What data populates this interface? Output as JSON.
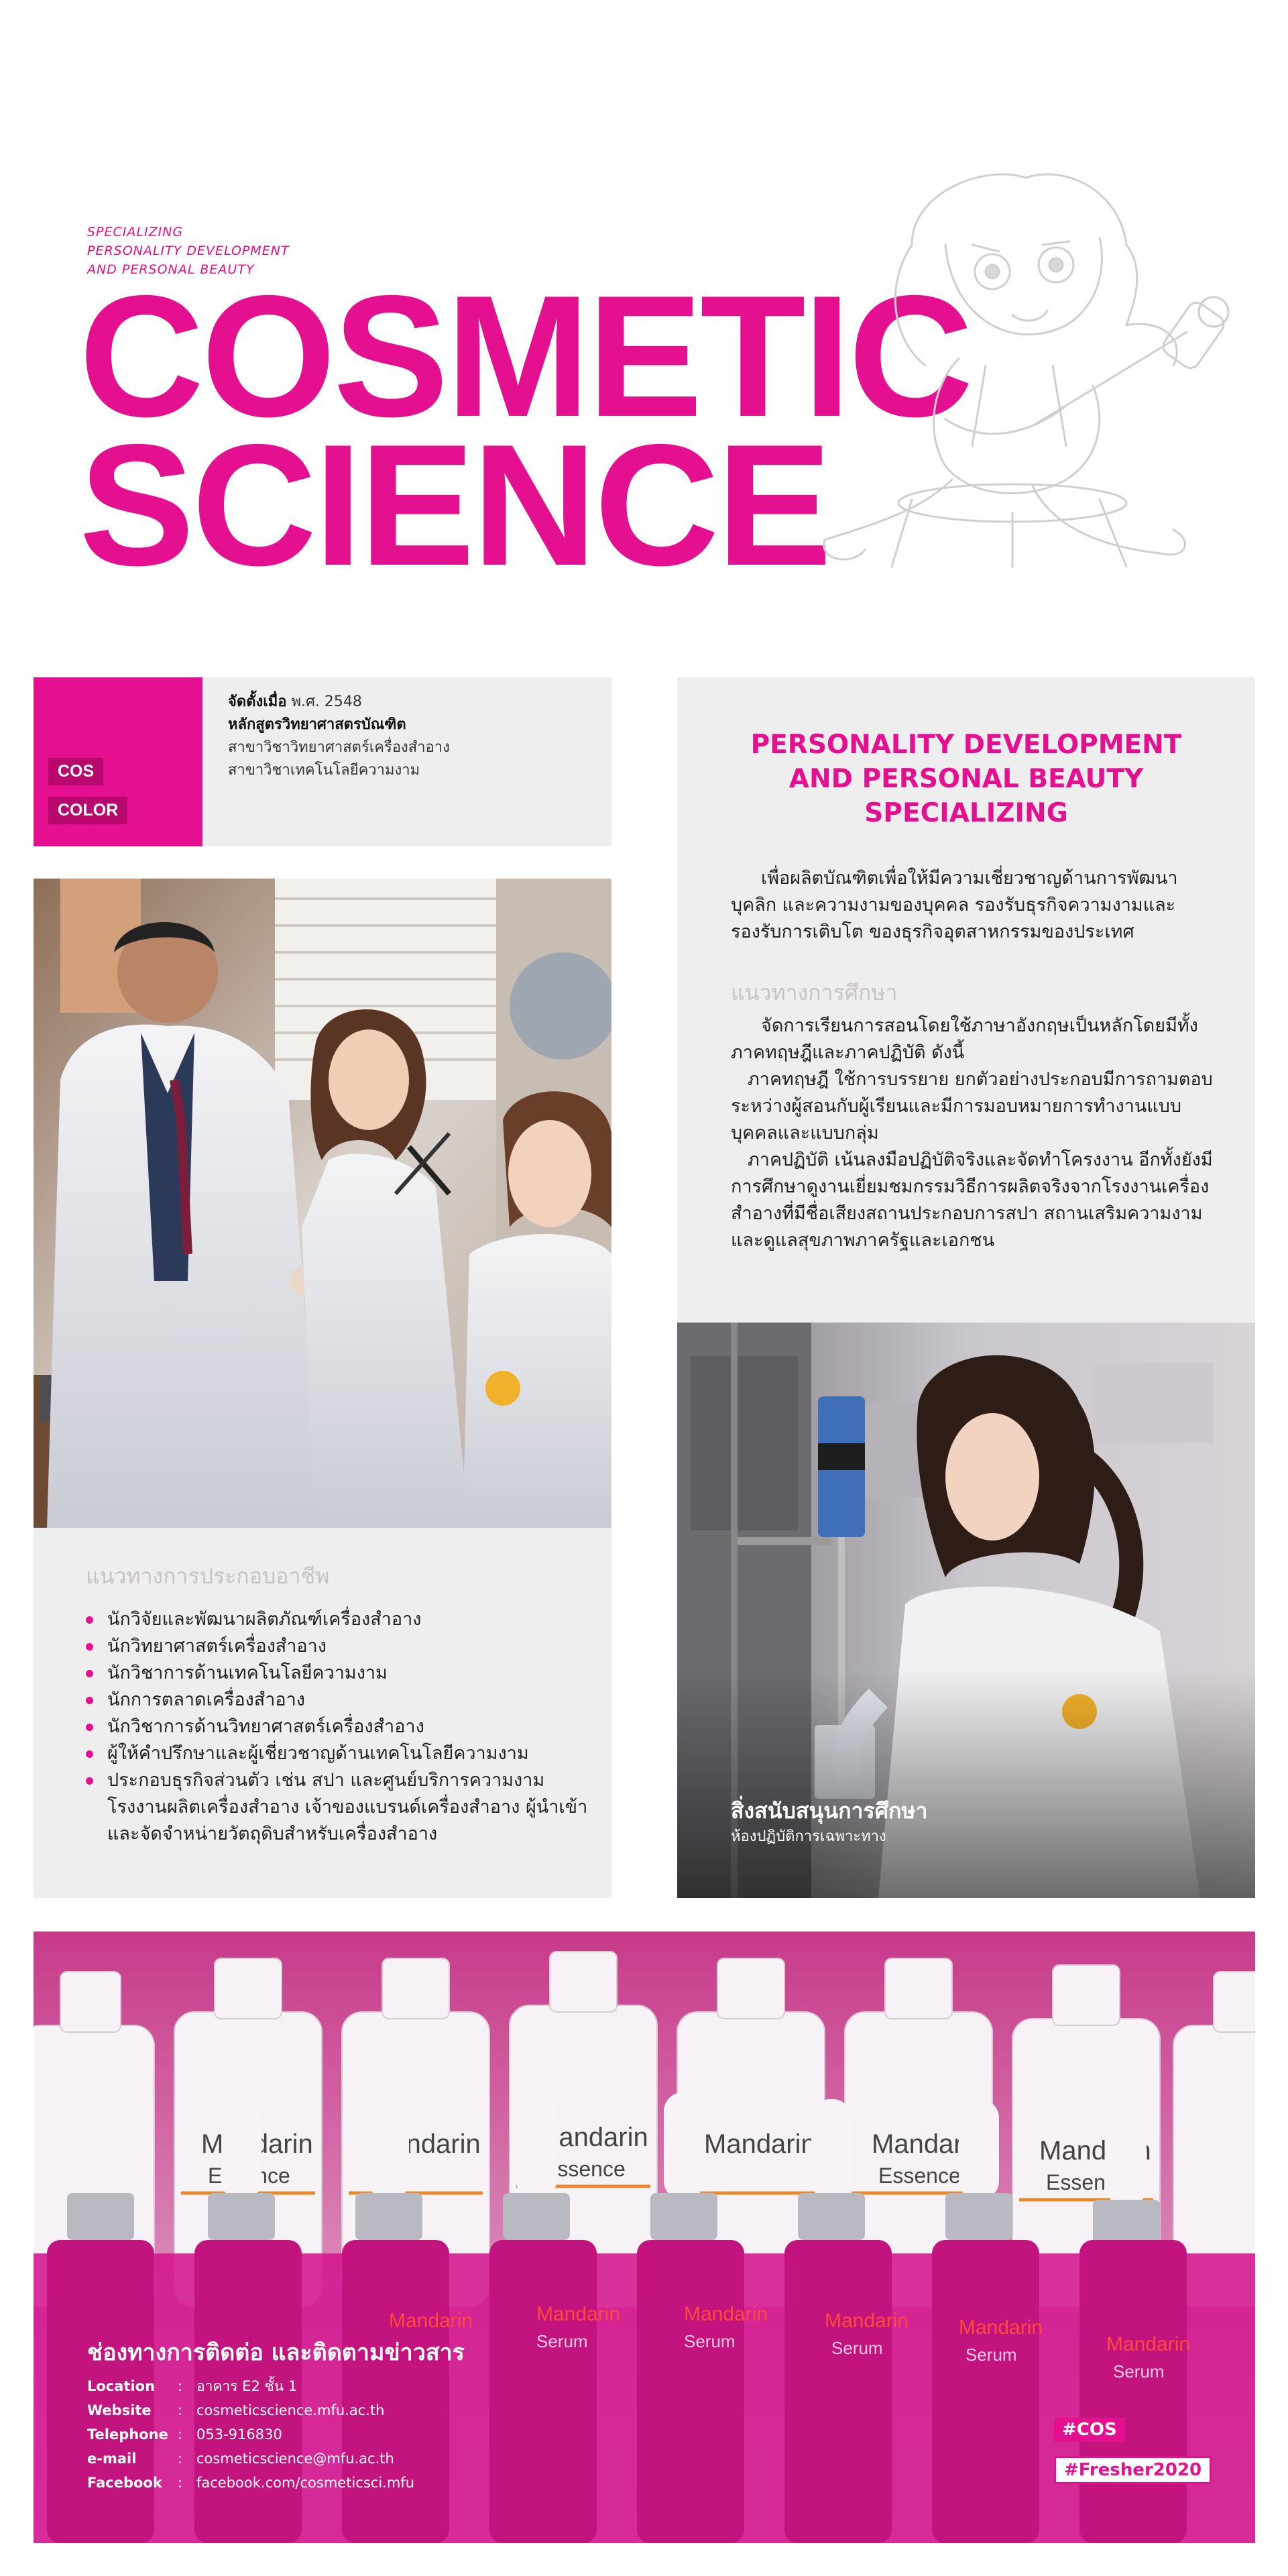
{
  "header": {
    "specializing_lines": [
      "SPECIALIZING",
      "PERSONALITY DEVELOPMENT",
      "AND PERSONAL BEAUTY"
    ],
    "title_lines": [
      "COSMETIC",
      "SCIENCE"
    ]
  },
  "info": {
    "tags": [
      "COS",
      "COLOR"
    ],
    "founded_label": "จัดตั้งเมื่อ",
    "founded_value": "พ.ศ. 2548",
    "degree": "หลักสูตรวิทยาศาสตรบัณฑิต",
    "majors": [
      "สาขาวิชาวิทยาศาสตร์เครื่องสำอาง",
      "สาขาวิชาเทคโนโลยีความงาม"
    ]
  },
  "program": {
    "title_lines": [
      "PERSONALITY DEVELOPMENT",
      "AND PERSONAL BEAUTY",
      "SPECIALIZING"
    ],
    "intro": "เพื่อผลิตบัณฑิตเพื่อให้มีความเชี่ยวชาญด้านการพัฒนาบุคลิก และความงามของบุคคล รองรับธุรกิจความงามและรองรับการเติบโต ของธุรกิจอุตสาหกรรมของประเทศ",
    "study_heading": "แนวทางการศึกษา",
    "study_paragraphs": [
      "จัดการเรียนการสอนโดยใช้ภาษาอังกฤษเป็นหลักโดยมีทั้งภาคทฤษฎีและภาคปฏิบัติ ดังนี้",
      "ภาคทฤษฎี ใช้การบรรยาย ยกตัวอย่างประกอบมีการถามตอบระหว่างผู้สอนกับผู้เรียนและมีการมอบหมายการทำงานแบบบุคคลและแบบกลุ่ม",
      "ภาคปฏิบัติ เน้นลงมือปฏิบัติจริงและจัดทำโครงงาน อีกทั้งยังมีการศึกษาดูงานเยี่ยมชมกรรมวิธีการผลิตจริงจากโรงงานเครื่องสำอางที่มีชื่อเสียงสถานประกอบการสปา สถานเสริมความงาม และดูแลสุขภาพภาครัฐและเอกชน"
    ]
  },
  "career": {
    "heading": "แนวทางการประกอบอาชีพ",
    "items": [
      "นักวิจัยและพัฒนาผลิตภัณฑ์เครื่องสำอาง",
      "นักวิทยาศาสตร์เครื่องสำอาง",
      "นักวิชาการด้านเทคโนโลยีความงาม",
      "นักการตลาดเครื่องสำอาง",
      "นักวิชาการด้านวิทยาศาสตร์เครื่องสำอาง",
      "ผู้ให้คำปรึกษาและผู้เชี่ยวชาญด้านเทคโนโลยีความงาม",
      "ประกอบธุรกิจส่วนตัว เช่น สปา และศูนย์บริการความงาม โรงงานผลิตเครื่องสำอาง เจ้าของแบรนด์เครื่องสำอาง ผู้นำเข้า และจัดจำหน่ายวัตถุดิบสำหรับเครื่องสำอาง"
    ]
  },
  "facility": {
    "title": "สิ่งสนับสนุนการศึกษา",
    "subtitle": "ห้องปฏิบัติการเฉพาะทาง"
  },
  "footer": {
    "title": "ช่องทางการติดต่อ และติดตามข่าวสาร",
    "contacts": [
      {
        "label": "Location",
        "value": "อาคาร E2 ชั้น 1"
      },
      {
        "label": "Website",
        "value": "cosmeticscience.mfu.ac.th"
      },
      {
        "label": "Telephone",
        "value": "053-916830"
      },
      {
        "label": "e-mail",
        "value": "cosmeticscience@mfu.ac.th"
      },
      {
        "label": "Facebook",
        "value": "facebook.com/cosmeticsci.mfu"
      }
    ],
    "separator": ":",
    "hashtags": [
      "#COS",
      "#Fresher2020"
    ],
    "bottle_label": "Mandarin",
    "bottle_sub": "Essence",
    "dropper_label": "Mandarin",
    "dropper_sub": "Serum"
  },
  "colors": {
    "accent": "#e4108f",
    "panel": "#efeeee",
    "muted_heading": "#c9c2c2"
  }
}
